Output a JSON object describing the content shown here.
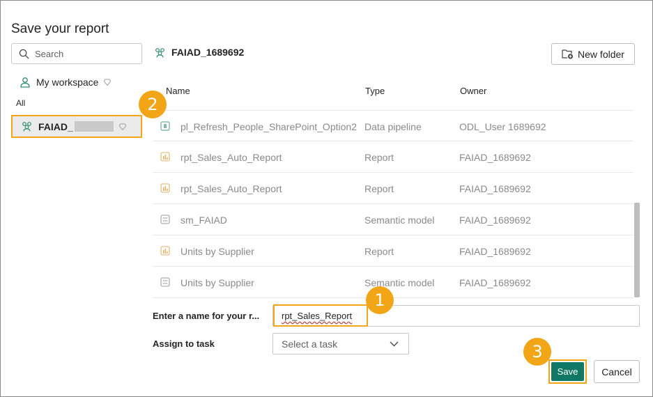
{
  "dialog": {
    "title": "Save your report"
  },
  "sidebar": {
    "search_placeholder": "Search",
    "my_workspace_label": "My workspace",
    "section_label": "All",
    "selected_workspace_label": "FAIAD_"
  },
  "header": {
    "breadcrumb": "FAIAD_1689692",
    "new_folder_label": "New folder"
  },
  "table": {
    "columns": [
      "Name",
      "Type",
      "Owner"
    ],
    "rows": [
      {
        "icon": "pipeline-icon",
        "name": "pl_Refresh_People_SharePoint_Option2",
        "type": "Data pipeline",
        "owner": "ODL_User 1689692"
      },
      {
        "icon": "report-icon",
        "name": "rpt_Sales_Auto_Report",
        "type": "Report",
        "owner": "FAIAD_1689692"
      },
      {
        "icon": "report-icon",
        "name": "rpt_Sales_Auto_Report",
        "type": "Report",
        "owner": "FAIAD_1689692"
      },
      {
        "icon": "semantic-model-icon",
        "name": "sm_FAIAD",
        "type": "Semantic model",
        "owner": "FAIAD_1689692"
      },
      {
        "icon": "report-icon",
        "name": "Units by Supplier",
        "type": "Report",
        "owner": "FAIAD_1689692"
      },
      {
        "icon": "semantic-model-icon",
        "name": "Units by Supplier",
        "type": "Semantic model",
        "owner": "FAIAD_1689692"
      }
    ]
  },
  "form": {
    "name_label": "Enter a name for your r...",
    "name_value": "rpt_Sales_Report",
    "task_label": "Assign to task",
    "task_placeholder": "Select a task"
  },
  "actions": {
    "save_label": "Save",
    "cancel_label": "Cancel"
  },
  "callouts": {
    "one": "1",
    "two": "2",
    "three": "3"
  },
  "colors": {
    "accent": "#117865",
    "callout": "#f2a516",
    "workspace_icon": "#2e8b6f"
  }
}
